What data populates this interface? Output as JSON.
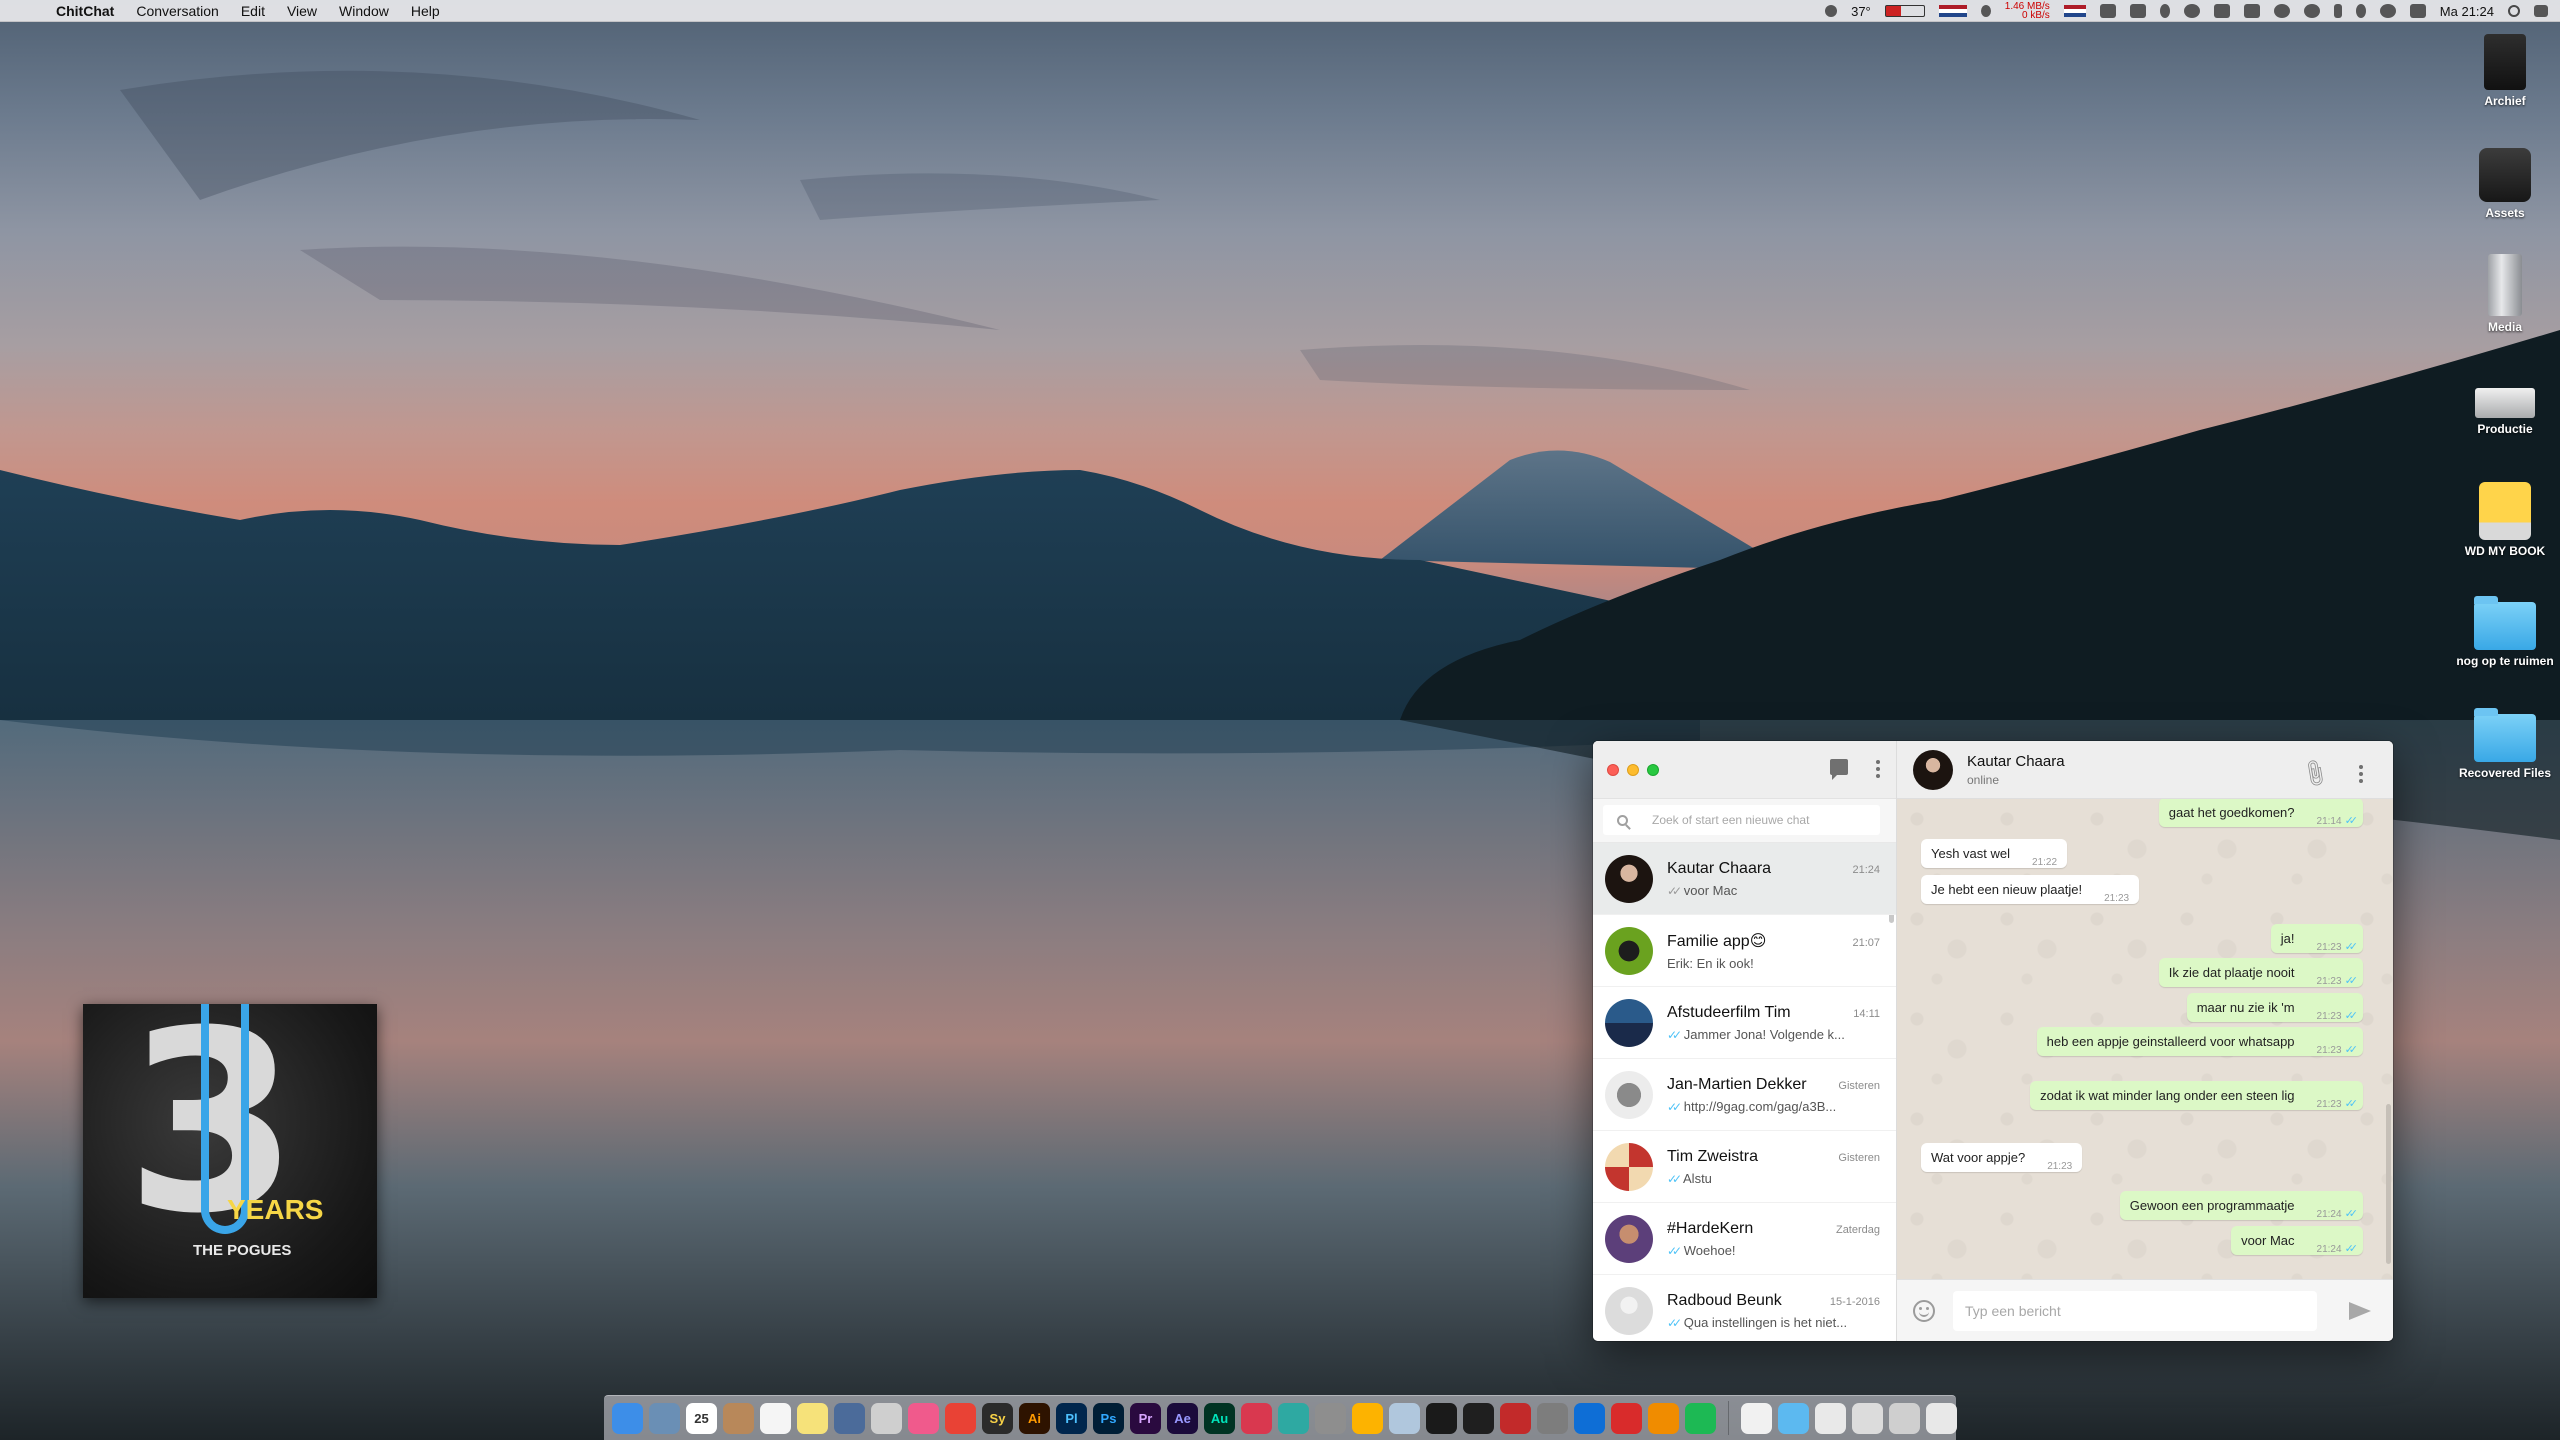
{
  "menubar": {
    "app_name": "ChitChat",
    "menus": [
      "Conversation",
      "Edit",
      "View",
      "Window",
      "Help"
    ],
    "temperature": "37°",
    "network_speed_up": "1.46 MB/s",
    "network_speed_down": "0 kB/s",
    "clock": "Ma 21:24"
  },
  "desktop_icons": [
    {
      "label": "Archief",
      "kind": "drive-black"
    },
    {
      "label": "Assets",
      "kind": "drive-dark"
    },
    {
      "label": "Media",
      "kind": "drive-grey"
    },
    {
      "label": "Productie",
      "kind": "drive-silver"
    },
    {
      "label": "WD MY BOOK",
      "kind": "drive-yellow"
    },
    {
      "label": "nog op te ruimen",
      "kind": "folder"
    },
    {
      "label": "Recovered Files",
      "kind": "folder"
    }
  ],
  "album": {
    "number": "3",
    "years": "YEARS",
    "band": "THE POGUES"
  },
  "sidebar": {
    "search_placeholder": "Zoek of start een nieuwe chat",
    "chats": [
      {
        "name": "Kautar Chaara",
        "time": "21:24",
        "preview": "voor Mac",
        "ticks": "grey",
        "active": true
      },
      {
        "name": "Familie app😊",
        "time": "21:07",
        "preview": "Erik: En ik ook!",
        "ticks": "none"
      },
      {
        "name": "Afstudeerfilm Tim",
        "time": "14:11",
        "preview": "Jammer Jona! Volgende k...",
        "ticks": "read"
      },
      {
        "name": "Jan-Martien Dekker",
        "time": "Gisteren",
        "preview": "http://9gag.com/gag/a3B...",
        "ticks": "read"
      },
      {
        "name": "Tim Zweistra",
        "time": "Gisteren",
        "preview": "Alstu",
        "ticks": "read"
      },
      {
        "name": "#HardeKern",
        "time": "Zaterdag",
        "preview": "Woehoe!",
        "ticks": "read"
      },
      {
        "name": "Radboud Beunk",
        "time": "15-1-2016",
        "preview": "Qua instellingen is het niet...",
        "ticks": "read"
      }
    ]
  },
  "conversation": {
    "contact_name": "Kautar Chaara",
    "contact_status": "online",
    "composer_placeholder": "Typ een bericht",
    "messages": [
      {
        "dir": "out",
        "text": "gaat het goedkomen?",
        "time": "21:14"
      },
      {
        "dir": "in",
        "text": "Yesh vast wel",
        "time": "21:22"
      },
      {
        "dir": "in",
        "text": "Je hebt een nieuw plaatje!",
        "time": "21:23"
      },
      {
        "dir": "out",
        "text": "ja!",
        "time": "21:23"
      },
      {
        "dir": "out",
        "text": "Ik zie dat plaatje nooit",
        "time": "21:23"
      },
      {
        "dir": "out",
        "text": "maar nu zie ik 'm",
        "time": "21:23"
      },
      {
        "dir": "out",
        "text": "heb een appje geinstalleerd voor whatsapp",
        "time": "21:23"
      },
      {
        "dir": "out",
        "text": "zodat ik wat minder lang onder een steen lig",
        "time": "21:23"
      },
      {
        "dir": "in",
        "text": "Wat voor appje?",
        "time": "21:23"
      },
      {
        "dir": "out",
        "text": "Gewoon een programmaatje",
        "time": "21:24"
      },
      {
        "dir": "out",
        "text": "voor Mac",
        "time": "21:24"
      }
    ]
  },
  "dock": {
    "apps": [
      {
        "name": "finder",
        "label": "",
        "color": "#3d8ee8"
      },
      {
        "name": "preview",
        "label": "",
        "color": "#6a8fb5"
      },
      {
        "name": "calendar",
        "label": "25",
        "color": "#ffffff"
      },
      {
        "name": "contacts",
        "label": "",
        "color": "#b8885a"
      },
      {
        "name": "notes",
        "label": "",
        "color": "#f5f5f5"
      },
      {
        "name": "stickies",
        "label": "",
        "color": "#f6e27a"
      },
      {
        "name": "xcode",
        "label": "",
        "color": "#4b6b9a"
      },
      {
        "name": "keyboard",
        "label": "",
        "color": "#cfcfcf"
      },
      {
        "name": "itunes",
        "label": "",
        "color": "#f05a8c"
      },
      {
        "name": "chrome",
        "label": "",
        "color": "#e94235"
      },
      {
        "name": "sublime",
        "label": "Sy",
        "color": "#2b2b2b",
        "fg": "#f7d147"
      },
      {
        "name": "illustrator",
        "label": "Ai",
        "color": "#2e1300",
        "fg": "#ff9a00"
      },
      {
        "name": "prelude",
        "label": "Pl",
        "color": "#00264d",
        "fg": "#4dc1ff"
      },
      {
        "name": "photoshop",
        "label": "Ps",
        "color": "#001e36",
        "fg": "#31a8ff"
      },
      {
        "name": "premiere",
        "label": "Pr",
        "color": "#2a0a3f",
        "fg": "#d8a6ff"
      },
      {
        "name": "after-effects",
        "label": "Ae",
        "color": "#1b0b3b",
        "fg": "#9999ff"
      },
      {
        "name": "audition",
        "label": "Au",
        "color": "#003323",
        "fg": "#00e4bb"
      },
      {
        "name": "davinci",
        "label": "",
        "color": "#d9384f"
      },
      {
        "name": "safari",
        "label": "",
        "color": "#2ea9a2"
      },
      {
        "name": "sequel",
        "label": "",
        "color": "#8e8e8e"
      },
      {
        "name": "sketch",
        "label": "",
        "color": "#fdb300"
      },
      {
        "name": "books",
        "label": "",
        "color": "#b0c7dd"
      },
      {
        "name": "terminal",
        "label": "",
        "color": "#1a1a1a"
      },
      {
        "name": "activity-monitor",
        "label": "",
        "color": "#1f1f1f"
      },
      {
        "name": "utility",
        "label": "",
        "color": "#c22a2a"
      },
      {
        "name": "system-preferences",
        "label": "",
        "color": "#7d7d7d"
      },
      {
        "name": "teamviewer",
        "label": "",
        "color": "#0e6ed6"
      },
      {
        "name": "toolbox",
        "label": "",
        "color": "#d92b2b"
      },
      {
        "name": "vlc",
        "label": "",
        "color": "#f08c00"
      },
      {
        "name": "spotify",
        "label": "",
        "color": "#1db954"
      },
      {
        "name": "chitchat",
        "label": "",
        "color": "#f1f1f1"
      },
      {
        "name": "applications-folder",
        "label": "",
        "color": "#5cb9f0"
      },
      {
        "name": "downloads-stack",
        "label": "",
        "color": "#e9e9e9"
      },
      {
        "name": "documents-stack",
        "label": "",
        "color": "#dcdcdc"
      },
      {
        "name": "screenshots-stack",
        "label": "",
        "color": "#cfcfcf"
      },
      {
        "name": "trash",
        "label": "",
        "color": "#e8e8e8"
      }
    ]
  }
}
